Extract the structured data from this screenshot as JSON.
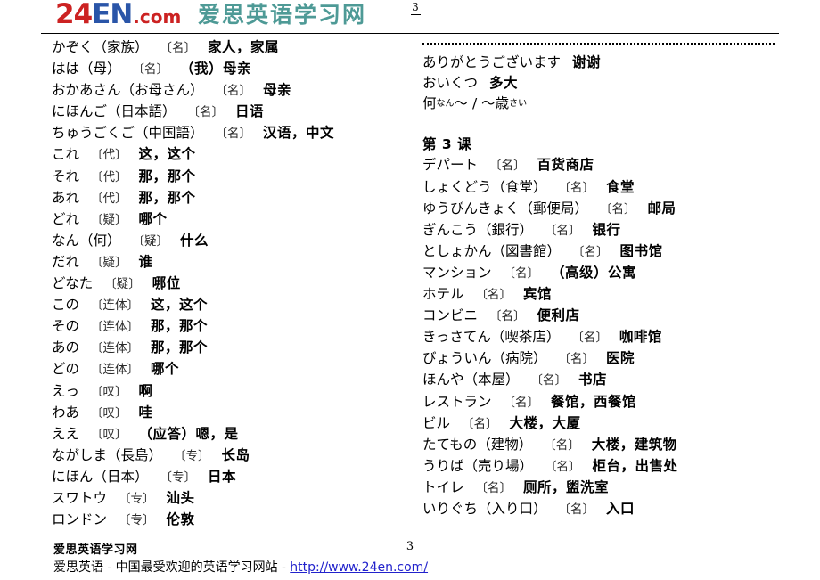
{
  "header": {
    "logo": {
      "part_24": "24",
      "part_en": "EN",
      "part_com": ".com",
      "color_24": "#CC2222",
      "color_en": "#2A55A8",
      "color_com": "#CC2222"
    },
    "site_name_cn": "爱思英语学习网",
    "site_name_color": "#4E9A96",
    "page_number_top": "3"
  },
  "left_column": {
    "entries": [
      {
        "word": "かぞく（家族）",
        "pos": "〔名〕",
        "gloss": "家人，家属"
      },
      {
        "word": "はは（母）",
        "pos": "〔名〕",
        "gloss": "（我）母亲"
      },
      {
        "word": "おかあさん（お母さん）",
        "pos": "〔名〕",
        "gloss": "母亲"
      },
      {
        "word": "にほんご（日本語）",
        "pos": "〔名〕",
        "gloss": "日语"
      },
      {
        "word": "ちゅうごくご（中国語）",
        "pos": "〔名〕",
        "gloss": "汉语，中文"
      },
      {
        "word": "これ",
        "pos": "〔代〕",
        "gloss": "这，这个"
      },
      {
        "word": "それ",
        "pos": "〔代〕",
        "gloss": "那，那个"
      },
      {
        "word": "あれ",
        "pos": "〔代〕",
        "gloss": "那，那个"
      },
      {
        "word": "どれ",
        "pos": "〔疑〕",
        "gloss": "哪个"
      },
      {
        "word": "なん（何）",
        "pos": "〔疑〕",
        "gloss": "什么"
      },
      {
        "word": "だれ",
        "pos": "〔疑〕",
        "gloss": "谁"
      },
      {
        "word": "どなた",
        "pos": "〔疑〕",
        "gloss": "哪位"
      },
      {
        "word": "この",
        "pos": "〔连体〕",
        "gloss": "这，这个"
      },
      {
        "word": "その",
        "pos": "〔连体〕",
        "gloss": "那，那个"
      },
      {
        "word": "あの",
        "pos": "〔连体〕",
        "gloss": "那，那个"
      },
      {
        "word": "どの",
        "pos": "〔连体〕",
        "gloss": "哪个"
      },
      {
        "word": "えっ",
        "pos": "〔叹〕",
        "gloss": "啊"
      },
      {
        "word": "わあ",
        "pos": "〔叹〕",
        "gloss": "哇"
      },
      {
        "word": "ええ",
        "pos": "〔叹〕",
        "gloss": "（应答）嗯，是"
      },
      {
        "word": "ながしま（長島）",
        "pos": "〔专〕",
        "gloss": "长岛"
      },
      {
        "word": "にほん（日本）",
        "pos": "〔专〕",
        "gloss": "日本"
      },
      {
        "word": "スワトウ",
        "pos": "〔专〕",
        "gloss": "汕头"
      },
      {
        "word": "ロンドン",
        "pos": "〔专〕",
        "gloss": "伦敦"
      }
    ]
  },
  "right_column": {
    "entries_top": [
      {
        "word": "ありがとうございます",
        "pos": "",
        "gloss": "谢谢"
      },
      {
        "word": "おいくつ",
        "pos": "",
        "gloss": "多大"
      }
    ],
    "ruby_line": {
      "base1": "何",
      "ruby1": "なん",
      "middle": "〜 / 〜",
      "base2": "歳",
      "ruby2": "さい"
    },
    "lesson_heading": "第 3 课",
    "entries_lesson": [
      {
        "word": "デパート",
        "pos": "〔名〕",
        "gloss": "百货商店"
      },
      {
        "word": "しょくどう（食堂）",
        "pos": "〔名〕",
        "gloss": "食堂"
      },
      {
        "word": "ゆうびんきょく（郵便局）",
        "pos": "〔名〕",
        "gloss": "邮局"
      },
      {
        "word": "ぎんこう（銀行）",
        "pos": "〔名〕",
        "gloss": "银行"
      },
      {
        "word": "としょかん（図書館）",
        "pos": "〔名〕",
        "gloss": "图书馆"
      },
      {
        "word": "マンション",
        "pos": "〔名〕",
        "gloss": "（高级）公寓"
      },
      {
        "word": "ホテル",
        "pos": "〔名〕",
        "gloss": "宾馆"
      },
      {
        "word": "コンビニ",
        "pos": "〔名〕",
        "gloss": "便利店"
      },
      {
        "word": "きっさてん（喫茶店）",
        "pos": "〔名〕",
        "gloss": "咖啡馆"
      },
      {
        "word": "びょういん（病院）",
        "pos": "〔名〕",
        "gloss": "医院"
      },
      {
        "word": "ほんや（本屋）",
        "pos": "〔名〕",
        "gloss": "书店"
      },
      {
        "word": "レストラン",
        "pos": "〔名〕",
        "gloss": "餐馆，西餐馆"
      },
      {
        "word": "ビル",
        "pos": "〔名〕",
        "gloss": "大楼，大厦"
      },
      {
        "word": "たてもの（建物）",
        "pos": "〔名〕",
        "gloss": "大楼，建筑物"
      },
      {
        "word": "うりば（売り場）",
        "pos": "〔名〕",
        "gloss": "柜台，出售处"
      },
      {
        "word": "トイレ",
        "pos": "〔名〕",
        "gloss": "厕所，盥洗室"
      },
      {
        "word": "いりぐち（入り口）",
        "pos": "〔名〕",
        "gloss": "入口"
      }
    ]
  },
  "footer": {
    "brand": "爱思英语学习网",
    "page_number": "3",
    "tagline": "爱思英语 - 中国最受欢迎的英语学习网站 - ",
    "url": "http://www.24en.com/",
    "url_color": "#2222CC"
  }
}
